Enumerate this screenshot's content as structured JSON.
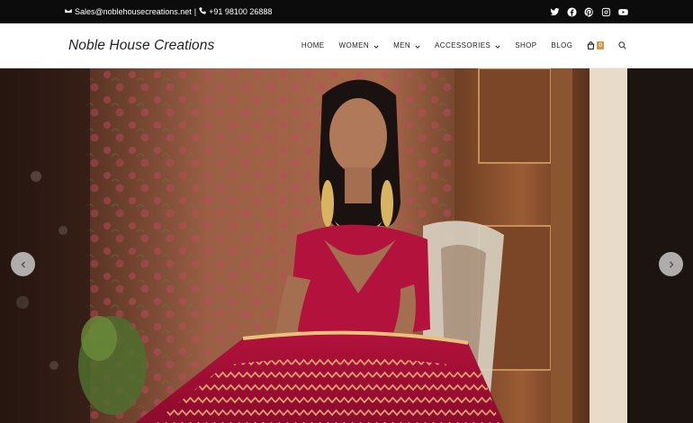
{
  "topbar": {
    "email": "Sales@noblehousecreations.net",
    "separator": "|",
    "phone": "+91 98100 26888",
    "social_icons": [
      "twitter-icon",
      "facebook-icon",
      "pinterest-icon",
      "instagram-icon",
      "youtube-icon"
    ]
  },
  "header": {
    "logo": "Noble House Creations",
    "nav": [
      {
        "label": "HOME",
        "dropdown": false
      },
      {
        "label": "WOMEN",
        "dropdown": true
      },
      {
        "label": "MEN",
        "dropdown": true
      },
      {
        "label": "ACCESSORIES",
        "dropdown": true
      },
      {
        "label": "SHOP",
        "dropdown": false
      },
      {
        "label": "BLOG",
        "dropdown": false
      }
    ],
    "cart_count": "0"
  },
  "colors": {
    "topbar_bg": "#0c0c0c",
    "accent": "#c89b4a",
    "lehenga_red": "#b3123c"
  },
  "hero": {
    "image": "model in red embroidered lehenga seated on chair",
    "prev_icon": "chevron-left-icon",
    "next_icon": "chevron-right-icon"
  }
}
